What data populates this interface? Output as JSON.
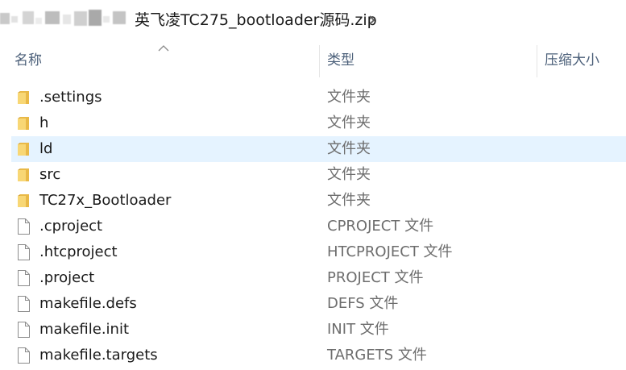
{
  "breadcrumb": {
    "current_folder": "英飞凌TC275_bootloader源码.zip"
  },
  "columns": {
    "name": "名称",
    "type": "类型",
    "compressed_size": "压缩大小",
    "sort_column": "name",
    "sort_direction": "ascending"
  },
  "colors": {
    "selection": "#e5f3ff",
    "folder": "#f8d775",
    "header_text": "#4c607a",
    "type_text": "#6d6d6d"
  },
  "items": [
    {
      "name": ".settings",
      "type": "文件夹",
      "icon": "folder-icon",
      "selected": false
    },
    {
      "name": "h",
      "type": "文件夹",
      "icon": "folder-icon",
      "selected": false
    },
    {
      "name": "ld",
      "type": "文件夹",
      "icon": "folder-icon",
      "selected": true
    },
    {
      "name": "src",
      "type": "文件夹",
      "icon": "folder-icon",
      "selected": false
    },
    {
      "name": "TC27x_Bootloader",
      "type": "文件夹",
      "icon": "folder-icon",
      "selected": false
    },
    {
      "name": ".cproject",
      "type": "CPROJECT 文件",
      "icon": "file-icon",
      "selected": false
    },
    {
      "name": ".htcproject",
      "type": "HTCPROJECT 文件",
      "icon": "file-icon",
      "selected": false
    },
    {
      "name": ".project",
      "type": "PROJECT 文件",
      "icon": "file-icon",
      "selected": false
    },
    {
      "name": "makefile.defs",
      "type": "DEFS 文件",
      "icon": "file-icon",
      "selected": false
    },
    {
      "name": "makefile.init",
      "type": "INIT 文件",
      "icon": "file-icon",
      "selected": false
    },
    {
      "name": "makefile.targets",
      "type": "TARGETS 文件",
      "icon": "file-icon",
      "selected": false
    }
  ]
}
